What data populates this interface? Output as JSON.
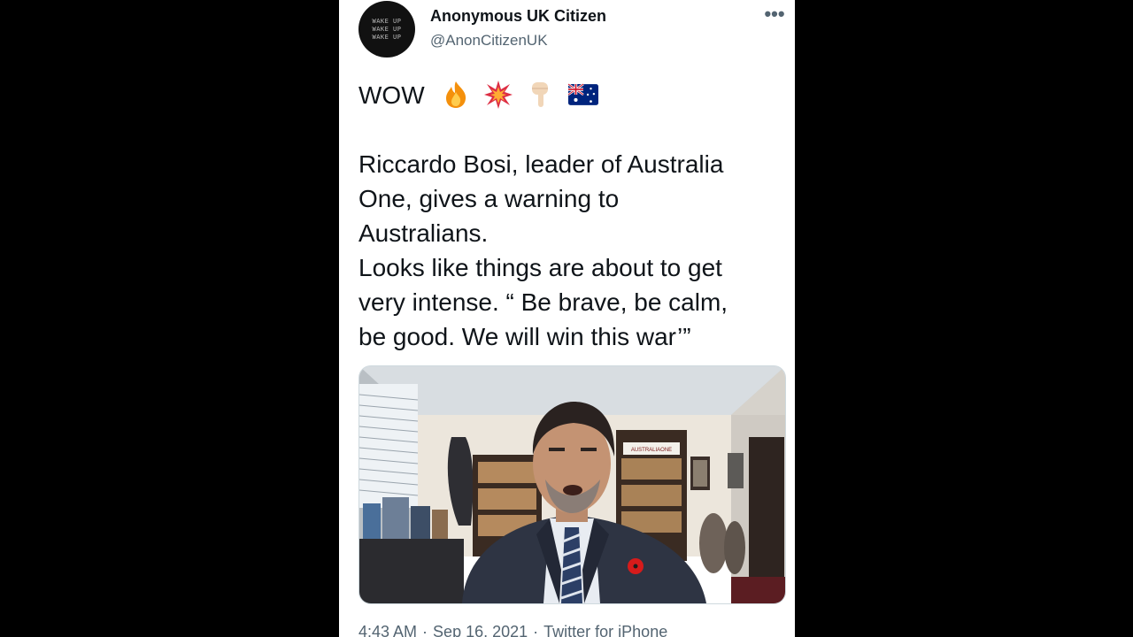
{
  "tweet": {
    "author": {
      "display_name": "Anonymous UK Citizen",
      "handle": "@AnonCitizenUK",
      "avatar_text": [
        "WAKE UP",
        "WAKE UP",
        "WAKE UP"
      ]
    },
    "more_icon": "•••",
    "text": {
      "exclamation": "WOW",
      "emojis": [
        "fire-icon",
        "explosion-icon",
        "pointing-down-icon",
        "australia-flag-icon"
      ],
      "lines": [
        "Riccardo Bosi, leader of Australia",
        "One, gives a warning to",
        "Australians.",
        "Looks like things are about to get",
        "very intense. “ Be brave, be calm,",
        "be good. We will win this war’”"
      ]
    },
    "media": {
      "type": "video",
      "banner_text": "AUSTRALIAONE"
    },
    "meta": {
      "time": "4:43 AM",
      "date": "Sep 16, 2021",
      "source": "Twitter for iPhone",
      "separator": "·"
    }
  },
  "colors": {
    "background": "#000000",
    "panel": "#ffffff",
    "text_primary": "#0f1419",
    "text_secondary": "#536471",
    "poppy_red": "#d61b1b"
  }
}
